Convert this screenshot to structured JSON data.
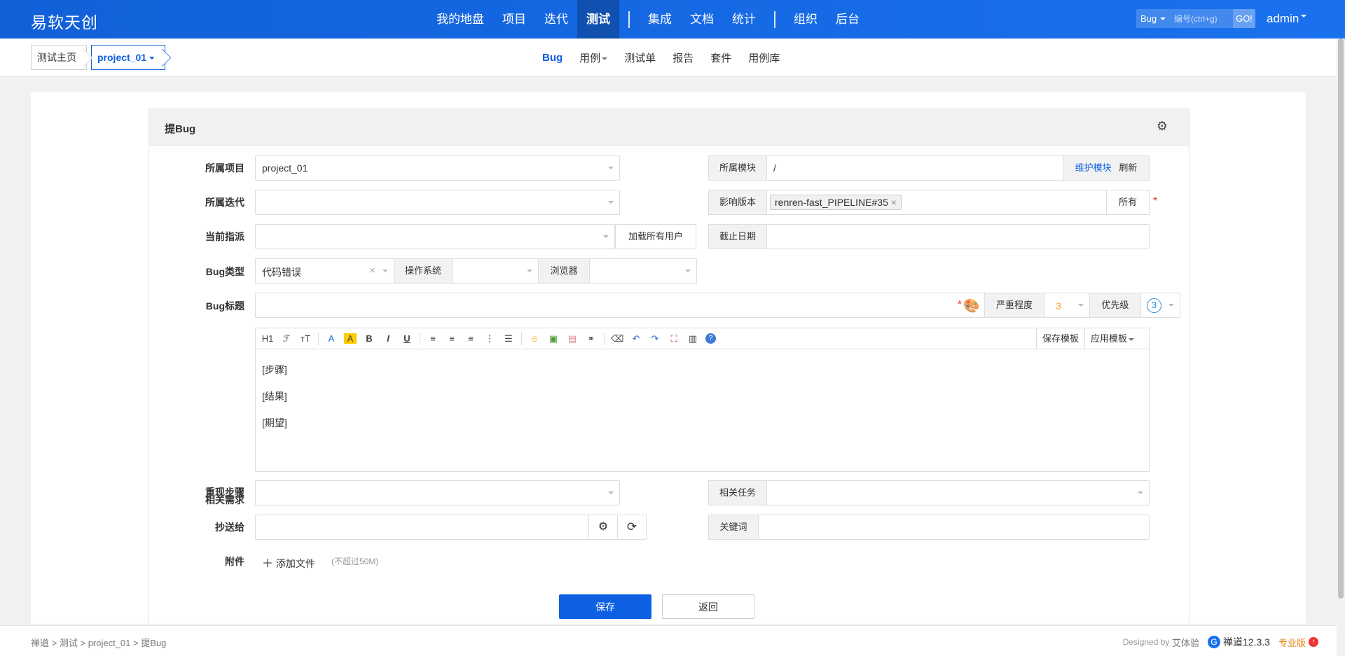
{
  "brand": "易软天创",
  "nav": {
    "items": [
      "我的地盘",
      "项目",
      "迭代",
      "测试",
      "集成",
      "文档",
      "统计",
      "组织",
      "后台"
    ],
    "active": "测试"
  },
  "search": {
    "type": "Bug",
    "placeholder": "编号(ctrl+g)",
    "go": "GO!"
  },
  "user": "admin",
  "breadcrumb": {
    "home": "测试主页",
    "project": "project_01"
  },
  "subnav": {
    "bug": "Bug",
    "case": "用例",
    "testtask": "测试单",
    "report": "报告",
    "suite": "套件",
    "caselib": "用例库"
  },
  "panel": {
    "title": "提Bug"
  },
  "form": {
    "product_label": "所属项目",
    "product_value": "project_01",
    "module_label": "所属模块",
    "module_value": "/",
    "module_maintain": "维护模块",
    "module_refresh": "刷新",
    "execution_label": "所属迭代",
    "execution_value": "",
    "build_label": "影响版本",
    "build_value": "renren-fast_PIPELINE#35",
    "build_all": "所有",
    "assign_label": "当前指派",
    "assign_value": "",
    "load_all_users": "加载所有用户",
    "deadline_label": "截止日期",
    "deadline_value": "",
    "type_label": "Bug类型",
    "type_value": "代码错误",
    "os_label": "操作系统",
    "os_value": "",
    "browser_label": "浏览器",
    "browser_value": "",
    "title_label": "Bug标题",
    "title_value": "",
    "severity_label": "严重程度",
    "severity_value": "3",
    "priority_label": "优先级",
    "priority_value": "3",
    "steps_label": "重现步骤",
    "steps_lines": [
      "[步骤]",
      "[结果]",
      "[期望]"
    ],
    "save_template": "保存模板",
    "apply_template": "应用模板",
    "story_label": "相关需求",
    "story_value": "",
    "task_label": "相关任务",
    "task_value": "",
    "mailto_label": "抄送给",
    "mailto_value": "",
    "keywords_label": "关键词",
    "keywords_value": "",
    "files_label": "附件",
    "add_file": "添加文件",
    "file_limit": "(不超过50M)"
  },
  "editor_toolbar": [
    "H1",
    "ℱ",
    "тT",
    "A",
    "A",
    "B",
    "I",
    "U",
    "≡",
    "≡",
    "≡",
    "⋮",
    "☰",
    "☺",
    "▣",
    "▤",
    "⚭",
    "⌫",
    "↶",
    "↷",
    "⛶",
    "▥",
    "?"
  ],
  "buttons": {
    "save": "保存",
    "back": "返回"
  },
  "footer": {
    "crumbs": [
      "禅道",
      "测试",
      "project_01",
      "提Bug"
    ],
    "designed_by": "Designed by",
    "designer": "艾体验",
    "version": "禅道12.3.3",
    "edition": "专业版"
  },
  "colors": {
    "primary": "#0c60e1",
    "nav_bg": "#1466e4",
    "required": "#ee3333"
  }
}
